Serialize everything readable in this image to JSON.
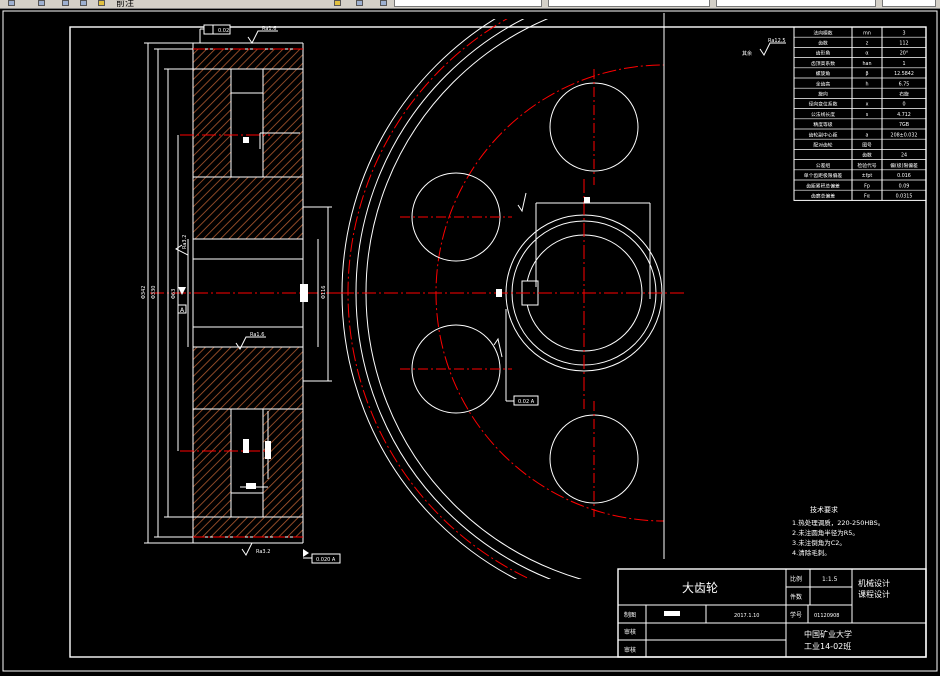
{
  "toolbar": {
    "menu_text": "前注",
    "tab_labels": [
      "",
      "",
      "",
      "",
      ""
    ]
  },
  "params_table": {
    "rows": [
      [
        "法向模数",
        "mn",
        "3"
      ],
      [
        "齿数",
        "z",
        "112"
      ],
      [
        "齿形角",
        "α",
        "20°"
      ],
      [
        "齿顶高系数",
        "han",
        "1"
      ],
      [
        "螺旋角",
        "β",
        "12.5842"
      ],
      [
        "全齿高",
        "h",
        "6.75"
      ],
      [
        "旋向",
        "",
        "右旋"
      ],
      [
        "径向变位系数",
        "x",
        "0"
      ],
      [
        "公法线长度",
        "s",
        "4.712"
      ],
      [
        "精度等级",
        "",
        "7GB"
      ],
      [
        "齿轮副中心距",
        "a",
        "208±0.032"
      ],
      [
        "配对齿轮",
        "图号",
        ""
      ],
      [
        "",
        "齿数",
        "24"
      ],
      [
        "公差组",
        "检验代号",
        "偏(极)限偏差"
      ],
      [
        "单个齿距极限偏差",
        "±fpt",
        "0.016"
      ],
      [
        "齿距累积总偏差",
        "Fp",
        "0.09"
      ],
      [
        "齿廓总偏差",
        "Fα",
        "0.0315"
      ]
    ]
  },
  "tech_req": {
    "title": "技术要求",
    "lines": [
      "1.热处理调质，220-250HBS。",
      "2.未注圆角半径为R5。",
      "3.未注倒角为C2。",
      "4.清除毛刺。"
    ]
  },
  "title_block": {
    "part_name": "大齿轮",
    "scale_label": "比例",
    "scale_value": "1:1.5",
    "count_label": "件数",
    "course_line1": "机械设计",
    "course_line2": "课程设计",
    "drawn_label": "制图",
    "date": "2017.1.10",
    "student_label": "学号",
    "student_no": "01120908",
    "check_label": "审核",
    "approve_label": "审核",
    "school": "中国矿业大学",
    "class_name": "工业14-02班"
  },
  "annotations": {
    "roughness_main": "Ra1.6",
    "roughness_bottom": "Ra3.2",
    "roughness_hub": "Ra1.6",
    "roughness_key": "Ra3.2",
    "remainder_label": "其余",
    "remainder_ra": "Ra12.5",
    "tolerance_frame": "0.020 A",
    "runout_frame": "0.02 A",
    "datum": "A",
    "top_frame": "0.02",
    "dim_outer": "Φ342",
    "dim_root": "Φ330",
    "dim_hub": "Φ116",
    "dim_bore": "Φ63",
    "dim_keyway": "67.3",
    "dim_width": "84",
    "dim_hub_len": "62"
  },
  "colors": {
    "line": "#ffffff",
    "center": "#ff0000",
    "hatch": "#b05a30",
    "background": "#000000"
  }
}
